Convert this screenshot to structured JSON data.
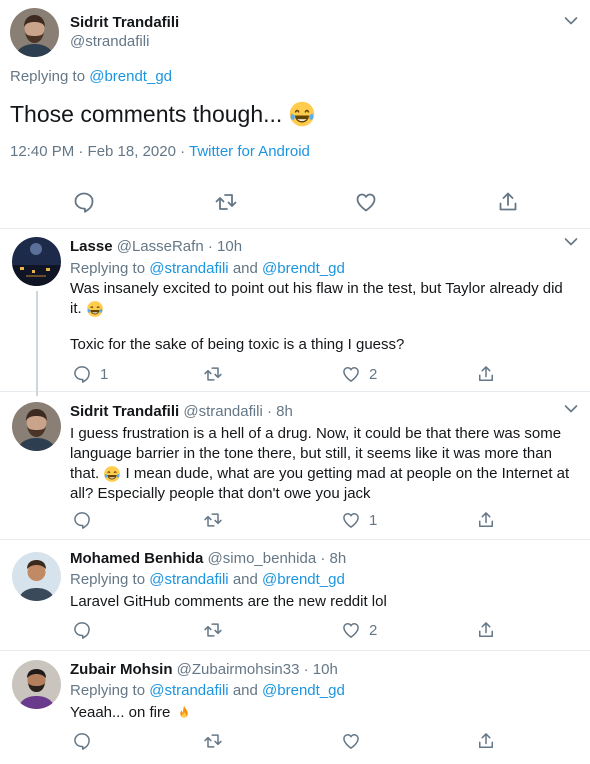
{
  "main_tweet": {
    "author_name": "Sidrit Trandafili",
    "author_handle": "@strandafili",
    "replying_prefix": "Replying to ",
    "replying_to": "@brendt_gd",
    "text": "Those comments though...",
    "emoji": "face-with-tears-of-joy",
    "timestamp": "12:40 PM · Feb 18, 2020 · ",
    "source": "Twitter for Android"
  },
  "replies": [
    {
      "name": "Lasse",
      "handle": "@LasseRafn",
      "time": "· 10h",
      "replying_prefix": "Replying to ",
      "replying_a": "@strandafili",
      "replying_and": " and ",
      "replying_b": "@brendt_gd",
      "line1": "Was insanely excited to point out his flaw in the test, but Taylor already did",
      "line2": "it.",
      "line3": "Toxic for the sake of being toxic is a thing I guess?",
      "reply_count": "1",
      "retweet_count": "",
      "like_count": "2"
    },
    {
      "name": "Sidrit Trandafili",
      "handle": "@strandafili",
      "time": "· 8h",
      "line1": "I guess frustration is a hell of a drug. Now, it could be that there was some",
      "line2": "language barrier in the tone there, but still, it seems like it was more than",
      "line3a": "that.",
      "line3b": "I mean dude, what are you getting mad at people on the Internet at",
      "line4": "all? Especially people that don't owe you jack",
      "reply_count": "",
      "retweet_count": "",
      "like_count": "1"
    },
    {
      "name": "Mohamed Benhida",
      "handle": "@simo_benhida",
      "time": "· 8h",
      "replying_prefix": "Replying to ",
      "replying_a": "@strandafili",
      "replying_and": " and ",
      "replying_b": "@brendt_gd",
      "line1": "Laravel GitHub comments are the new reddit lol",
      "reply_count": "",
      "retweet_count": "",
      "like_count": "2"
    },
    {
      "name": "Zubair Mohsin",
      "handle": "@Zubairmohsin33",
      "time": "· 10h",
      "replying_prefix": "Replying to ",
      "replying_a": "@strandafili",
      "replying_and": " and ",
      "replying_b": "@brendt_gd",
      "line1": "Yeaah... on fire",
      "reply_count": "",
      "retweet_count": "",
      "like_count": ""
    }
  ],
  "colors": {
    "link": "#1b95e0",
    "secondary": "#657786",
    "text": "#14171a",
    "divider": "#e6ecf0"
  },
  "icons": [
    "reply-icon",
    "retweet-icon",
    "like-icon",
    "share-icon",
    "caret-down-icon",
    "laughing-emoji-icon",
    "fire-emoji-icon"
  ]
}
